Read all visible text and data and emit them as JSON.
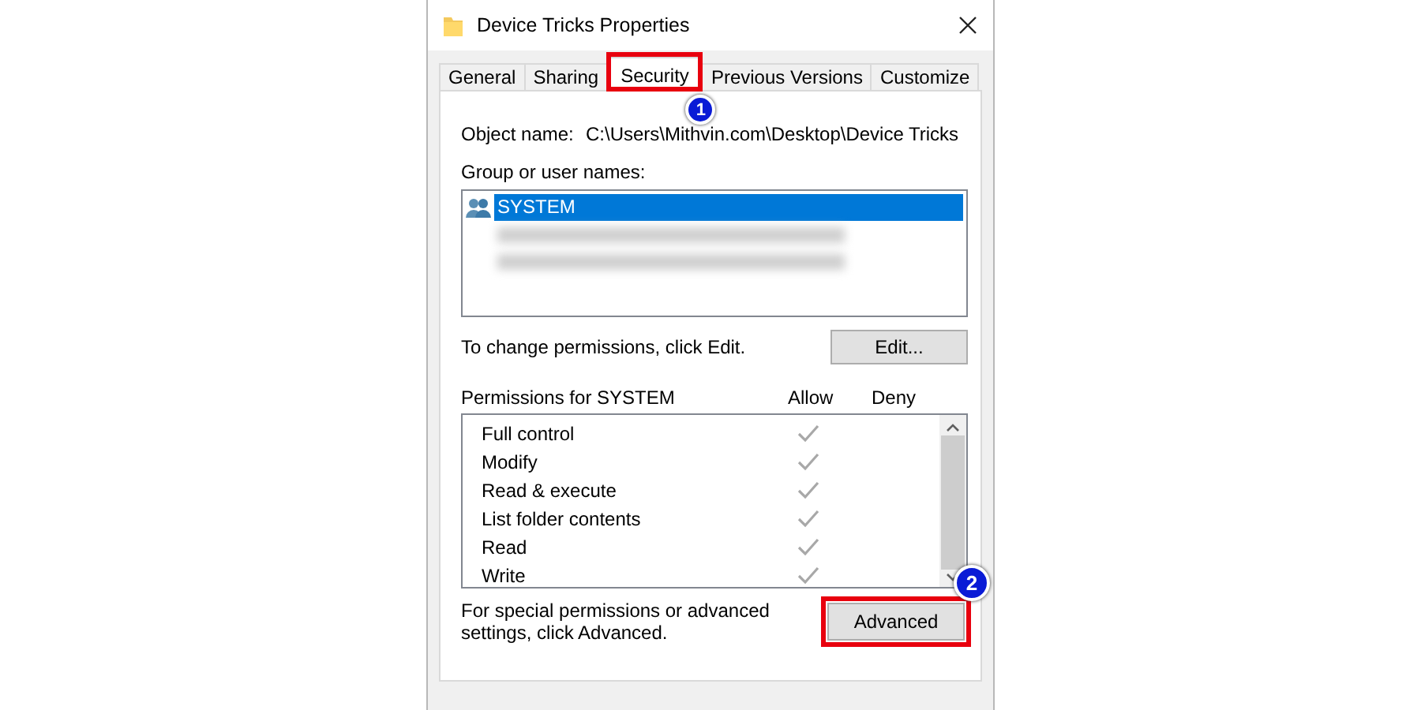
{
  "window": {
    "title": "Device Tricks Properties"
  },
  "tabs": [
    {
      "label": "General",
      "selected": false,
      "highlighted": false
    },
    {
      "label": "Sharing",
      "selected": false,
      "highlighted": false
    },
    {
      "label": "Security",
      "selected": true,
      "highlighted": true,
      "marker": "1"
    },
    {
      "label": "Previous Versions",
      "selected": false,
      "highlighted": false
    },
    {
      "label": "Customize",
      "selected": false,
      "highlighted": false
    }
  ],
  "object_name": {
    "label": "Object name:",
    "value": "C:\\Users\\Mithvin.com\\Desktop\\Device Tricks"
  },
  "users": {
    "label": "Group or user names:",
    "items": [
      {
        "kind": "group",
        "name": "SYSTEM",
        "selected": true
      },
      {
        "kind": "blurred",
        "selected": false
      },
      {
        "kind": "blurred",
        "selected": false
      }
    ]
  },
  "edit_hint": "To change permissions, click Edit.",
  "edit_button": {
    "label": "Edit..."
  },
  "permissions": {
    "title": "Permissions for SYSTEM",
    "allow_label": "Allow",
    "deny_label": "Deny",
    "rows": [
      {
        "name": "Full control",
        "allow": true,
        "deny": false
      },
      {
        "name": "Modify",
        "allow": true,
        "deny": false
      },
      {
        "name": "Read & execute",
        "allow": true,
        "deny": false
      },
      {
        "name": "List folder contents",
        "allow": true,
        "deny": false
      },
      {
        "name": "Read",
        "allow": true,
        "deny": false
      },
      {
        "name": "Write",
        "allow": true,
        "deny": false
      }
    ]
  },
  "advanced_hint": "For special permissions or advanced settings, click Advanced.",
  "advanced_button": {
    "label": "Advanced",
    "highlighted": true,
    "marker": "2"
  }
}
